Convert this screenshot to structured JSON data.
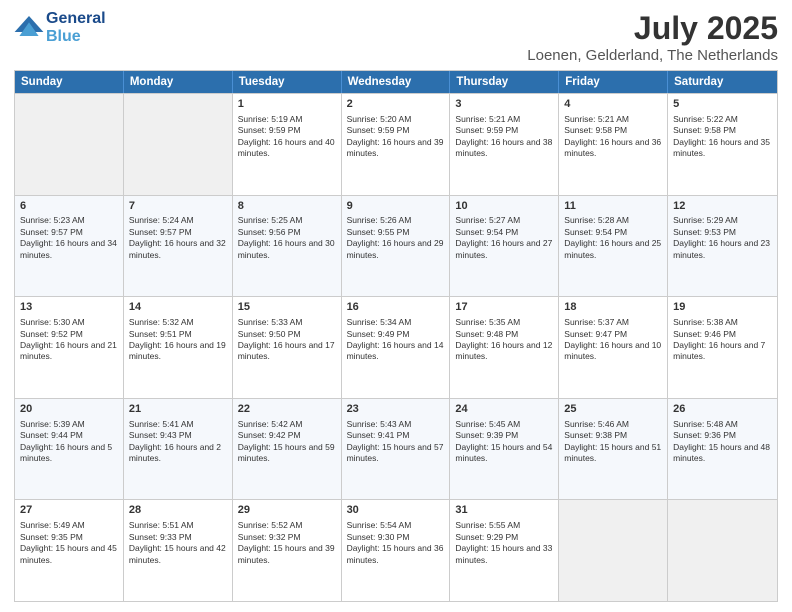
{
  "header": {
    "logo_line1": "General",
    "logo_line2": "Blue",
    "title": "July 2025",
    "subtitle": "Loenen, Gelderland, The Netherlands"
  },
  "days": [
    "Sunday",
    "Monday",
    "Tuesday",
    "Wednesday",
    "Thursday",
    "Friday",
    "Saturday"
  ],
  "weeks": [
    [
      {
        "num": "",
        "empty": true
      },
      {
        "num": "",
        "empty": true
      },
      {
        "num": "1",
        "sunrise": "5:19 AM",
        "sunset": "9:59 PM",
        "daylight": "16 hours and 40 minutes."
      },
      {
        "num": "2",
        "sunrise": "5:20 AM",
        "sunset": "9:59 PM",
        "daylight": "16 hours and 39 minutes."
      },
      {
        "num": "3",
        "sunrise": "5:21 AM",
        "sunset": "9:59 PM",
        "daylight": "16 hours and 38 minutes."
      },
      {
        "num": "4",
        "sunrise": "5:21 AM",
        "sunset": "9:58 PM",
        "daylight": "16 hours and 36 minutes."
      },
      {
        "num": "5",
        "sunrise": "5:22 AM",
        "sunset": "9:58 PM",
        "daylight": "16 hours and 35 minutes."
      }
    ],
    [
      {
        "num": "6",
        "sunrise": "5:23 AM",
        "sunset": "9:57 PM",
        "daylight": "16 hours and 34 minutes."
      },
      {
        "num": "7",
        "sunrise": "5:24 AM",
        "sunset": "9:57 PM",
        "daylight": "16 hours and 32 minutes."
      },
      {
        "num": "8",
        "sunrise": "5:25 AM",
        "sunset": "9:56 PM",
        "daylight": "16 hours and 30 minutes."
      },
      {
        "num": "9",
        "sunrise": "5:26 AM",
        "sunset": "9:55 PM",
        "daylight": "16 hours and 29 minutes."
      },
      {
        "num": "10",
        "sunrise": "5:27 AM",
        "sunset": "9:54 PM",
        "daylight": "16 hours and 27 minutes."
      },
      {
        "num": "11",
        "sunrise": "5:28 AM",
        "sunset": "9:54 PM",
        "daylight": "16 hours and 25 minutes."
      },
      {
        "num": "12",
        "sunrise": "5:29 AM",
        "sunset": "9:53 PM",
        "daylight": "16 hours and 23 minutes."
      }
    ],
    [
      {
        "num": "13",
        "sunrise": "5:30 AM",
        "sunset": "9:52 PM",
        "daylight": "16 hours and 21 minutes."
      },
      {
        "num": "14",
        "sunrise": "5:32 AM",
        "sunset": "9:51 PM",
        "daylight": "16 hours and 19 minutes."
      },
      {
        "num": "15",
        "sunrise": "5:33 AM",
        "sunset": "9:50 PM",
        "daylight": "16 hours and 17 minutes."
      },
      {
        "num": "16",
        "sunrise": "5:34 AM",
        "sunset": "9:49 PM",
        "daylight": "16 hours and 14 minutes."
      },
      {
        "num": "17",
        "sunrise": "5:35 AM",
        "sunset": "9:48 PM",
        "daylight": "16 hours and 12 minutes."
      },
      {
        "num": "18",
        "sunrise": "5:37 AM",
        "sunset": "9:47 PM",
        "daylight": "16 hours and 10 minutes."
      },
      {
        "num": "19",
        "sunrise": "5:38 AM",
        "sunset": "9:46 PM",
        "daylight": "16 hours and 7 minutes."
      }
    ],
    [
      {
        "num": "20",
        "sunrise": "5:39 AM",
        "sunset": "9:44 PM",
        "daylight": "16 hours and 5 minutes."
      },
      {
        "num": "21",
        "sunrise": "5:41 AM",
        "sunset": "9:43 PM",
        "daylight": "16 hours and 2 minutes."
      },
      {
        "num": "22",
        "sunrise": "5:42 AM",
        "sunset": "9:42 PM",
        "daylight": "15 hours and 59 minutes."
      },
      {
        "num": "23",
        "sunrise": "5:43 AM",
        "sunset": "9:41 PM",
        "daylight": "15 hours and 57 minutes."
      },
      {
        "num": "24",
        "sunrise": "5:45 AM",
        "sunset": "9:39 PM",
        "daylight": "15 hours and 54 minutes."
      },
      {
        "num": "25",
        "sunrise": "5:46 AM",
        "sunset": "9:38 PM",
        "daylight": "15 hours and 51 minutes."
      },
      {
        "num": "26",
        "sunrise": "5:48 AM",
        "sunset": "9:36 PM",
        "daylight": "15 hours and 48 minutes."
      }
    ],
    [
      {
        "num": "27",
        "sunrise": "5:49 AM",
        "sunset": "9:35 PM",
        "daylight": "15 hours and 45 minutes."
      },
      {
        "num": "28",
        "sunrise": "5:51 AM",
        "sunset": "9:33 PM",
        "daylight": "15 hours and 42 minutes."
      },
      {
        "num": "29",
        "sunrise": "5:52 AM",
        "sunset": "9:32 PM",
        "daylight": "15 hours and 39 minutes."
      },
      {
        "num": "30",
        "sunrise": "5:54 AM",
        "sunset": "9:30 PM",
        "daylight": "15 hours and 36 minutes."
      },
      {
        "num": "31",
        "sunrise": "5:55 AM",
        "sunset": "9:29 PM",
        "daylight": "15 hours and 33 minutes."
      },
      {
        "num": "",
        "empty": true
      },
      {
        "num": "",
        "empty": true
      }
    ]
  ]
}
